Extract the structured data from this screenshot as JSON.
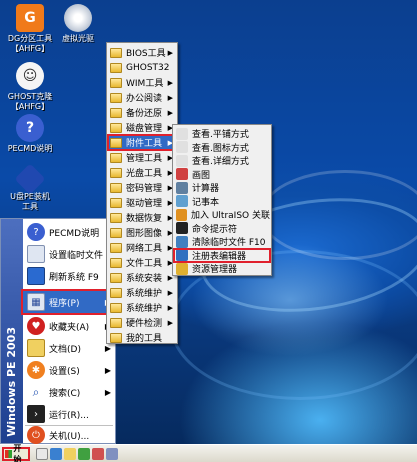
{
  "desktop_icons": [
    {
      "name": "dg-partition-icon",
      "label_line1": "DG分区工具",
      "label_line2": "【AHFG】"
    },
    {
      "name": "virtual-cdrom-icon",
      "label_line1": "虚拟光驱",
      "label_line2": ""
    },
    {
      "name": "ghost-icon",
      "label_line1": "GHOST克隆",
      "label_line2": "【AHFG】"
    },
    {
      "name": "pecmd-help-icon",
      "label_line1": "PECMD说明",
      "label_line2": ""
    },
    {
      "name": "udisk-pe-icon",
      "label_line1": "U盘PE装机",
      "label_line2": "工具"
    }
  ],
  "start_menu": {
    "banner": "Windows PE 2003",
    "items": [
      {
        "label": "PECMD说明",
        "arrow": ""
      },
      {
        "label": "设置临时文件",
        "arrow": ""
      },
      {
        "label": "刷新系统 F9",
        "arrow": ""
      },
      {
        "label": "程序(P)",
        "arrow": "▶"
      },
      {
        "label": "收藏夹(A)",
        "arrow": "▶"
      },
      {
        "label": "文档(D)",
        "arrow": "▶"
      },
      {
        "label": "设置(S)",
        "arrow": "▶"
      },
      {
        "label": "搜索(C)",
        "arrow": "▶"
      },
      {
        "label": "运行(R)...",
        "arrow": ""
      },
      {
        "label": "关机(U)...",
        "arrow": ""
      }
    ]
  },
  "programs_menu": {
    "items": [
      "BIOS工具",
      "GHOST32",
      "WIM工具",
      "办公阅读",
      "备份还原",
      "磁盘管理",
      "附件工具",
      "管理工具",
      "光盘工具",
      "密码管理",
      "驱动管理",
      "数据恢复",
      "图形图像",
      "网络工具",
      "文件工具",
      "系统安装",
      "系统维护",
      "系统维护",
      "硬件检测",
      "我的工具"
    ]
  },
  "accessories_menu": {
    "items": [
      "查看.平铺方式",
      "查看.图标方式",
      "查看.详细方式",
      "画图",
      "计算器",
      "记事本",
      "加入 UltraISO 关联",
      "命令提示符",
      "清除临时文件 F10",
      "注册表编辑器",
      "资源管理器"
    ]
  },
  "taskbar": {
    "start_label": "开始"
  }
}
